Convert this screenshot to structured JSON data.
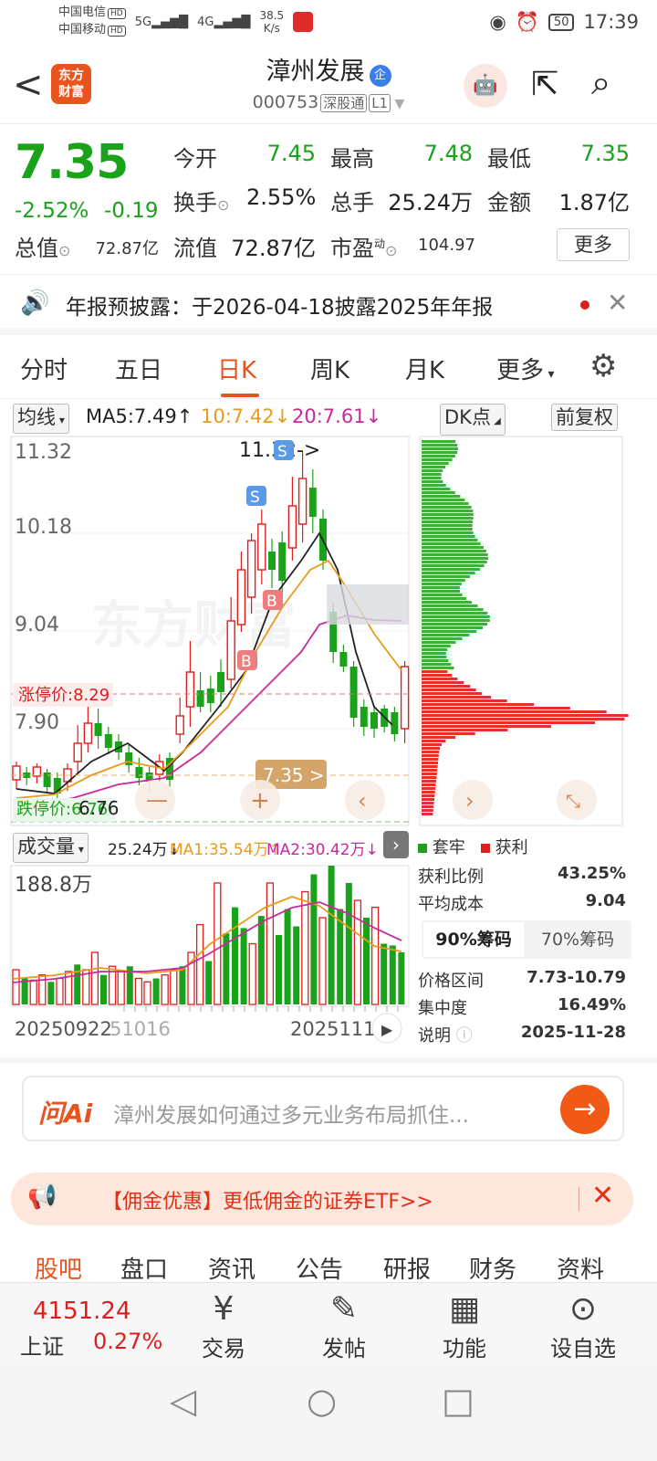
{
  "status": {
    "carrier1": "中国电信",
    "carrier2": "中国移动",
    "hd": "HD",
    "net1": "5G",
    "net2": "4G",
    "speed_value": "38.5",
    "speed_unit": "K/s",
    "battery": "50",
    "time": "17:39"
  },
  "header": {
    "back": "<",
    "logo_line1": "东方",
    "logo_line2": "财富",
    "name": "漳州发展",
    "badge": "企",
    "code": "000753",
    "tag1": "深股通",
    "tag2": "L1"
  },
  "quote": {
    "price": "7.35",
    "change_pct": "-2.52%",
    "change": "-0.19",
    "open_label": "今开",
    "open": "7.45",
    "high_label": "最高",
    "high": "7.48",
    "low_label": "最低",
    "low": "7.35",
    "turnover_label": "换手",
    "turnover": "2.55%",
    "volume_label": "总手",
    "volume": "25.24万",
    "amount_label": "金额",
    "amount": "1.87亿",
    "mcap_label": "总值",
    "mcap": "72.87亿",
    "float_label": "流值",
    "float": "72.87亿",
    "pe_label": "市盈",
    "pe_sup": "动",
    "pe": "104.97",
    "more": "更多"
  },
  "notice": {
    "text": "年报预披露：于2026-04-18披露2025年年报"
  },
  "tabs": [
    "分时",
    "五日",
    "日K",
    "周K",
    "月K",
    "更多"
  ],
  "active_tab": "日K",
  "ma": {
    "select": "均线",
    "ma5": "MA5:7.49",
    "ma10": "10:7.42",
    "ma20": "20:7.61",
    "dk": "DK点",
    "fq": "前复权"
  },
  "kchart": {
    "price_labels": [
      "11.32",
      "10.18",
      "9.04",
      "7.90"
    ],
    "peak_label": "11.32->",
    "limit_up": "涨停价:8.29",
    "limit_down": "跌停价:6.76",
    "low_label": "6.76",
    "current": "7.35 >",
    "watermark": "东方财富",
    "markers": {
      "s": "S",
      "b": "B"
    }
  },
  "volume": {
    "select": "成交量",
    "vol": "25.24万",
    "ma1": "MA1:35.54万",
    "ma2": "MA2:30.42万",
    "max_label": "188.8万",
    "date_left": "20250922",
    "date_mid": "51016",
    "date_right": "2025111"
  },
  "chips": {
    "legend_trap": "套牢",
    "legend_profit": "获利",
    "profit_ratio_label": "获利比例",
    "profit_ratio": "43.25%",
    "avg_cost_label": "平均成本",
    "avg_cost": "9.04",
    "tab90": "90%筹码",
    "tab70": "70%筹码",
    "range_label": "价格区间",
    "range": "7.73-10.79",
    "concentration_label": "集中度",
    "concentration": "16.49%",
    "desc_label": "说明",
    "date": "2025-11-28"
  },
  "ai": {
    "logo": "问Ai",
    "placeholder": "漳州发展如何通过多元业务布局抓住..."
  },
  "promo": {
    "text": "【佣金优惠】更低佣金的证券ETF>>"
  },
  "subtabs": [
    "股吧",
    "盘口",
    "资讯",
    "公告",
    "研报",
    "财务",
    "资料"
  ],
  "bottom": {
    "index_value": "4151.24",
    "index_name": "上证",
    "index_pct": "0.27%",
    "nav": [
      "交易",
      "发帖",
      "功能",
      "设自选"
    ]
  },
  "colors": {
    "up": "#e01d1d",
    "down": "#1aa31a",
    "accent": "#e8541e"
  }
}
